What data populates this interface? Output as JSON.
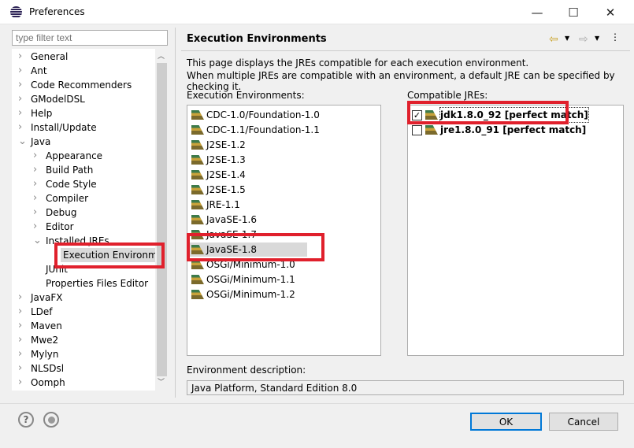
{
  "window": {
    "title": "Preferences",
    "minimize": "—",
    "maximize": "☐",
    "close": "✕"
  },
  "filter": {
    "placeholder": "type filter text"
  },
  "tree": [
    {
      "label": "General",
      "level": 0,
      "expander": "collapsed"
    },
    {
      "label": "Ant",
      "level": 0,
      "expander": "collapsed"
    },
    {
      "label": "Code Recommenders",
      "level": 0,
      "expander": "collapsed"
    },
    {
      "label": "GModelDSL",
      "level": 0,
      "expander": "collapsed"
    },
    {
      "label": "Help",
      "level": 0,
      "expander": "collapsed"
    },
    {
      "label": "Install/Update",
      "level": 0,
      "expander": "collapsed"
    },
    {
      "label": "Java",
      "level": 0,
      "expander": "expanded"
    },
    {
      "label": "Appearance",
      "level": 1,
      "expander": "collapsed"
    },
    {
      "label": "Build Path",
      "level": 1,
      "expander": "collapsed"
    },
    {
      "label": "Code Style",
      "level": 1,
      "expander": "collapsed"
    },
    {
      "label": "Compiler",
      "level": 1,
      "expander": "collapsed"
    },
    {
      "label": "Debug",
      "level": 1,
      "expander": "collapsed"
    },
    {
      "label": "Editor",
      "level": 1,
      "expander": "collapsed"
    },
    {
      "label": "Installed JREs",
      "level": 1,
      "expander": "expanded"
    },
    {
      "label": "Execution Environments",
      "level": 2,
      "expander": "none",
      "selected": true
    },
    {
      "label": "JUnit",
      "level": 1,
      "expander": "none"
    },
    {
      "label": "Properties Files Editor",
      "level": 1,
      "expander": "none"
    },
    {
      "label": "JavaFX",
      "level": 0,
      "expander": "collapsed"
    },
    {
      "label": "LDef",
      "level": 0,
      "expander": "collapsed"
    },
    {
      "label": "Maven",
      "level": 0,
      "expander": "collapsed"
    },
    {
      "label": "Mwe2",
      "level": 0,
      "expander": "collapsed"
    },
    {
      "label": "Mylyn",
      "level": 0,
      "expander": "collapsed"
    },
    {
      "label": "NLSDsl",
      "level": 0,
      "expander": "collapsed"
    },
    {
      "label": "Oomph",
      "level": 0,
      "expander": "collapsed"
    }
  ],
  "page": {
    "title": "Execution Environments",
    "desc1": "This page displays the JREs compatible for each execution environment.",
    "desc2": "When multiple JREs are compatible with an environment, a default JRE can be specified by checking it.",
    "env_label": "Execution Environments:",
    "jre_label": "Compatible JREs:",
    "environments": [
      "CDC-1.0/Foundation-1.0",
      "CDC-1.1/Foundation-1.1",
      "J2SE-1.2",
      "J2SE-1.3",
      "J2SE-1.4",
      "J2SE-1.5",
      "JRE-1.1",
      "JavaSE-1.6",
      "JavaSE-1.7",
      "JavaSE-1.8",
      "OSGi/Minimum-1.0",
      "OSGi/Minimum-1.1",
      "OSGi/Minimum-1.2"
    ],
    "selected_environment": "JavaSE-1.8",
    "jres": [
      {
        "label": "jdk1.8.0_92 [perfect match]",
        "checked": true
      },
      {
        "label": "jre1.8.0_91 [perfect match]",
        "checked": false
      }
    ],
    "envdesc_label": "Environment description:",
    "envdesc_value": "Java Platform, Standard Edition 8.0"
  },
  "buttons": {
    "ok": "OK",
    "cancel": "Cancel",
    "help": "?"
  },
  "colors": {
    "highlight": "#e0202c",
    "selection": "#d9d9d9",
    "ok_border": "#0078d7"
  }
}
